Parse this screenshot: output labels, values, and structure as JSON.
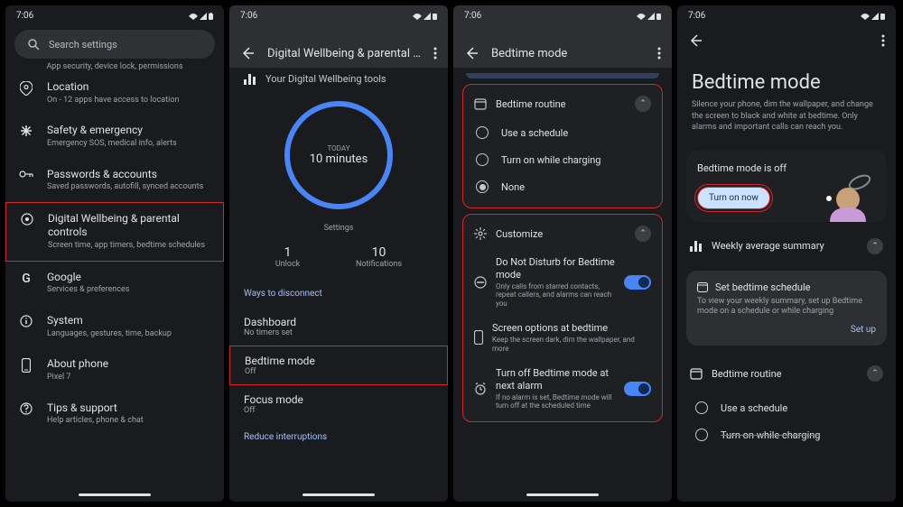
{
  "time": "7:06",
  "screens": {
    "settings": {
      "search_placeholder": "Search settings",
      "truncated_row": "App security, device lock, permissions",
      "items": [
        {
          "title": "Location",
          "sub": "On - 12 apps have access to location",
          "icon": "location"
        },
        {
          "title": "Safety & emergency",
          "sub": "Emergency SOS, medical info, alerts",
          "icon": "asterisk"
        },
        {
          "title": "Passwords & accounts",
          "sub": "Saved passwords, autofill, synced accounts",
          "icon": "key"
        },
        {
          "title": "Digital Wellbeing & parental controls",
          "sub": "Screen time, app timers, bedtime schedules",
          "icon": "wellbeing",
          "highlight": true
        },
        {
          "title": "Google",
          "sub": "Services & preferences",
          "icon": "google"
        },
        {
          "title": "System",
          "sub": "Languages, gestures, time, backup",
          "icon": "info"
        },
        {
          "title": "About phone",
          "sub": "Pixel 7",
          "icon": "phone"
        },
        {
          "title": "Tips & support",
          "sub": "Help articles, phone & chat",
          "icon": "help"
        }
      ]
    },
    "wellbeing": {
      "title": "Digital Wellbeing & parental co...",
      "tools_label": "Your Digital Wellbeing tools",
      "ring": {
        "label": "TODAY",
        "value": "10 minutes"
      },
      "settings_label": "Settings",
      "stats": [
        {
          "n": "1",
          "l": "Unlock"
        },
        {
          "n": "10",
          "l": "Notifications"
        }
      ],
      "link1": "Ways to disconnect",
      "dashboard": {
        "t": "Dashboard",
        "s": "No timers set"
      },
      "bedtime": {
        "t": "Bedtime mode",
        "s": "Off",
        "highlight": true
      },
      "focus": {
        "t": "Focus mode",
        "s": "Off"
      },
      "link2": "Reduce interruptions"
    },
    "bedtime": {
      "title": "Bedtime mode",
      "routine": {
        "label": "Bedtime routine",
        "options": [
          "Use a schedule",
          "Turn on while charging",
          "None"
        ],
        "selected": 2,
        "highlight": true
      },
      "customize": {
        "label": "Customize",
        "items": [
          {
            "t": "Do Not Disturb for Bedtime mode",
            "s": "Only calls from starred contacts, repeat callers, and alarms can reach you",
            "on": true,
            "icon": "dnd"
          },
          {
            "t": "Screen options at bedtime",
            "s": "Keep the screen dark, dim the wallpaper, and more",
            "icon": "phone"
          },
          {
            "t": "Turn off Bedtime mode at next alarm",
            "s": "If no alarm is set, Bedtime mode will turn off at the scheduled time",
            "on": true,
            "icon": "alarm"
          }
        ],
        "highlight": true
      }
    },
    "landing": {
      "title": "Bedtime mode",
      "desc": "Silence your phone, dim the wallpaper, and change the screen to black and white at bedtime. Only alarms and important calls can reach you.",
      "hero": {
        "status": "Bedtime mode is off",
        "btn": "Turn on now"
      },
      "summary": "Weekly average summary",
      "info": {
        "t": "Set bedtime schedule",
        "s": "To view your weekly summary, set up Bedtime mode on a schedule or while charging",
        "link": "Set up"
      },
      "routine": {
        "label": "Bedtime routine",
        "options": [
          "Use a schedule",
          "Turn on while charging"
        ]
      }
    }
  }
}
